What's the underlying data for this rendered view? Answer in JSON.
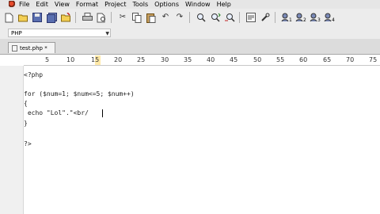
{
  "menubar": {
    "items": [
      "File",
      "Edit",
      "View",
      "Format",
      "Project",
      "Tools",
      "Options",
      "Window",
      "Help"
    ]
  },
  "toolbar": {
    "icons": [
      "new-file-icon",
      "open-folder-icon",
      "save-icon",
      "save-all-icon",
      "open-project-icon",
      "print-icon",
      "print-preview-icon",
      "cut-icon",
      "copy-icon",
      "paste-icon",
      "undo-icon",
      "redo-icon",
      "find-icon",
      "find-next-icon",
      "replace-icon",
      "goto-line-icon",
      "tools-icon",
      "tool-1-icon",
      "tool-2-icon",
      "tool-3-icon",
      "tool-4-icon"
    ]
  },
  "language": {
    "selected": "PHP"
  },
  "tabs": [
    {
      "label": "test.php *"
    }
  ],
  "ruler": {
    "labels": [
      "5",
      "10",
      "15",
      "20",
      "25",
      "30",
      "35",
      "40",
      "45",
      "50",
      "55",
      "60",
      "65",
      "70",
      "75"
    ]
  },
  "editor": {
    "lines": [
      "<?php",
      "",
      "for ($num=1; $num<=5; $num++)",
      "{",
      " echo \"Lol\".\"<br/",
      "}",
      "",
      "",
      "?>"
    ]
  }
}
